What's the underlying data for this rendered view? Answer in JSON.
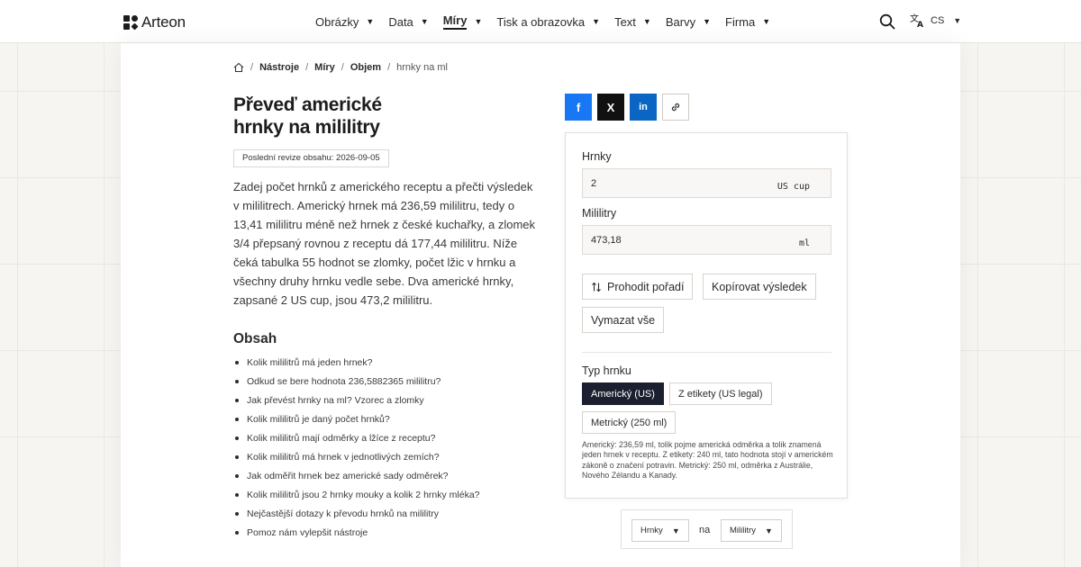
{
  "header": {
    "logo_text": "Arteon",
    "nav": [
      {
        "label": "Obrázky",
        "active": false
      },
      {
        "label": "Data",
        "active": false
      },
      {
        "label": "Míry",
        "active": true
      },
      {
        "label": "Tisk a obrazovka",
        "active": false
      },
      {
        "label": "Text",
        "active": false
      },
      {
        "label": "Barvy",
        "active": false
      },
      {
        "label": "Firma",
        "active": false
      }
    ],
    "search_icon": "search-icon",
    "lang_code": "CS",
    "lang_icon": "translate-icon"
  },
  "breadcrumb": {
    "home_icon": "home-icon",
    "items": [
      "Nástroje",
      "Míry",
      "Objem"
    ],
    "current": "hrnky na ml"
  },
  "article": {
    "title_line1": "Převeď americké",
    "title_line2": "hrnky na mililitry",
    "revision": "Poslední revize obsahu: 2026-09-05",
    "intro": "Zadej počet hrnků z amerického receptu a přečti výsledek v mililitrech. Americký hrnek má 236,59 mililitru, tedy o 13,41 mililitru méně než hrnek z české kuchařky, a zlomek 3/4 přepsaný rovnou z receptu dá 177,44 mililitru. Níže čeká tabulka 55 hodnot se zlomky, počet lžic v hrnku a všechny druhy hrnku vedle sebe. Dva americké hrnky, zapsané 2 US cup, jsou 473,2 mililitru.",
    "toc_title": "Obsah",
    "toc": [
      "Kolik mililitrů má jeden hrnek?",
      "Odkud se bere hodnota 236,5882365 mililitru?",
      "Jak převést hrnky na ml? Vzorec a zlomky",
      "Kolik mililitrů je daný počet hrnků?",
      "Kolik mililitrů mají odměrky a lžíce z receptu?",
      "Kolik mililitrů má hrnek v jednotlivých zemích?",
      "Jak odměřit hrnek bez americké sady odměrek?",
      "Kolik mililitrů jsou 2 hrnky mouky a kolik 2 hrnky mléka?",
      "Nejčastější dotazy k převodu hrnků na mililitry",
      "Pomoz nám vylepšit nástroje"
    ]
  },
  "share": {
    "facebook_glyph": "f",
    "x_glyph": "X",
    "linkedin_glyph": "in",
    "icons": [
      "facebook-icon",
      "x-icon",
      "linkedin-icon",
      "link-icon"
    ],
    "colors": {
      "facebook": "#1877f2",
      "x": "#111111",
      "linkedin": "#0a66c2"
    }
  },
  "converter": {
    "from_label": "Hrnky",
    "from_value": "2",
    "from_unit": "US cup",
    "to_label": "Mililitry",
    "to_value": "473,18",
    "to_unit": "ml",
    "swap_label": "Prohodit pořadí",
    "copy_label": "Kopírovat výsledek",
    "clear_label": "Vymazat vše",
    "cup_type_label": "Typ hrnku",
    "cup_types": [
      {
        "label": "Americký (US)",
        "selected": true
      },
      {
        "label": "Z etikety (US legal)",
        "selected": false
      },
      {
        "label": "Metrický (250 ml)",
        "selected": false
      }
    ],
    "note": "Americký: 236,59 ml, tolik pojme americká odměrka a tolik znamená jeden hrnek v receptu. Z etikety: 240 ml, tato hodnota stojí v americkém zákoně o značení potravin. Metrický: 250 ml, odměrka z Austrálie, Nového Zélandu a Kanady."
  },
  "unit_selector": {
    "from": "Hrnky",
    "connector": "na",
    "to": "Mililitry"
  },
  "colors": {
    "accent_dark": "#1b1f2f",
    "background": "#f7f5f2"
  }
}
